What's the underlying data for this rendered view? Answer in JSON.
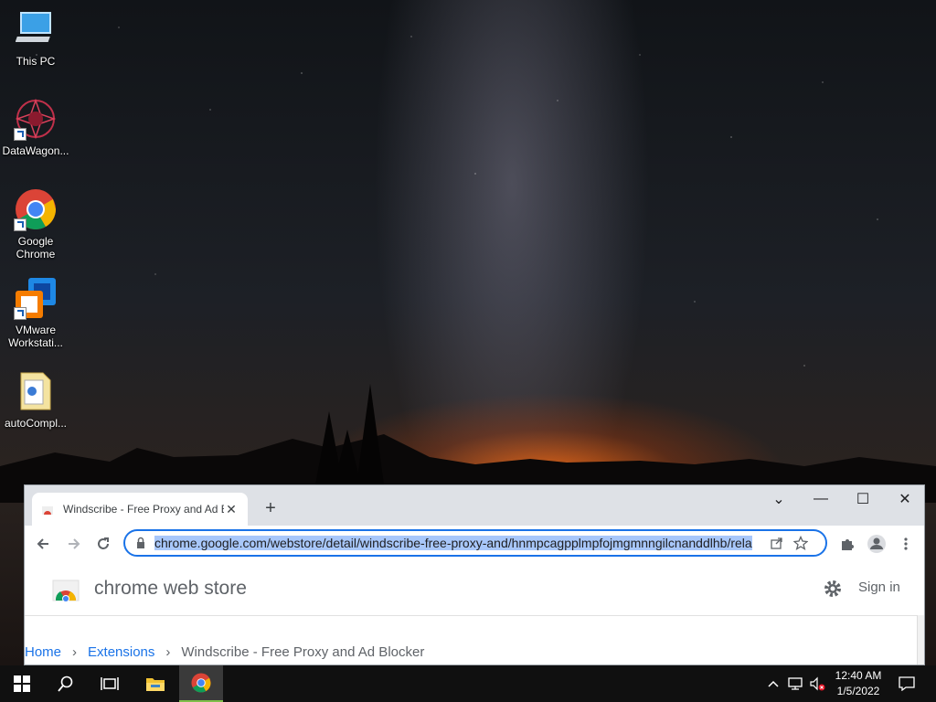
{
  "desktop": {
    "icons": [
      {
        "label": "This PC",
        "icon": "this-pc-icon"
      },
      {
        "label": "DataWagon...",
        "icon": "datawagon-icon"
      },
      {
        "label": "Google Chrome",
        "icon": "chrome-icon"
      },
      {
        "label": "VMware Workstati...",
        "icon": "vmware-icon"
      },
      {
        "label": "autoCompl...",
        "icon": "file-icon"
      }
    ]
  },
  "browser": {
    "tab": {
      "title": "Windscribe - Free Proxy and Ad Blocker"
    },
    "window_controls": {
      "dropdown": "⌄",
      "minimize": "—",
      "maximize": "☐",
      "close": "✕"
    },
    "omnibox": {
      "url": "chrome.google.com/webstore/detail/windscribe-free-proxy-and/hnmpcagpplmpfojmgmnngilcnanddlhb/rela"
    },
    "store": {
      "name": "chrome web store",
      "sign_in": "Sign in"
    },
    "breadcrumb": {
      "home": "Home",
      "extensions": "Extensions",
      "current": "Windscribe - Free Proxy and Ad Blocker",
      "separator": "›"
    }
  },
  "taskbar": {
    "time": "12:40 AM",
    "date": "1/5/2022",
    "accent": "#7fbf4a"
  }
}
